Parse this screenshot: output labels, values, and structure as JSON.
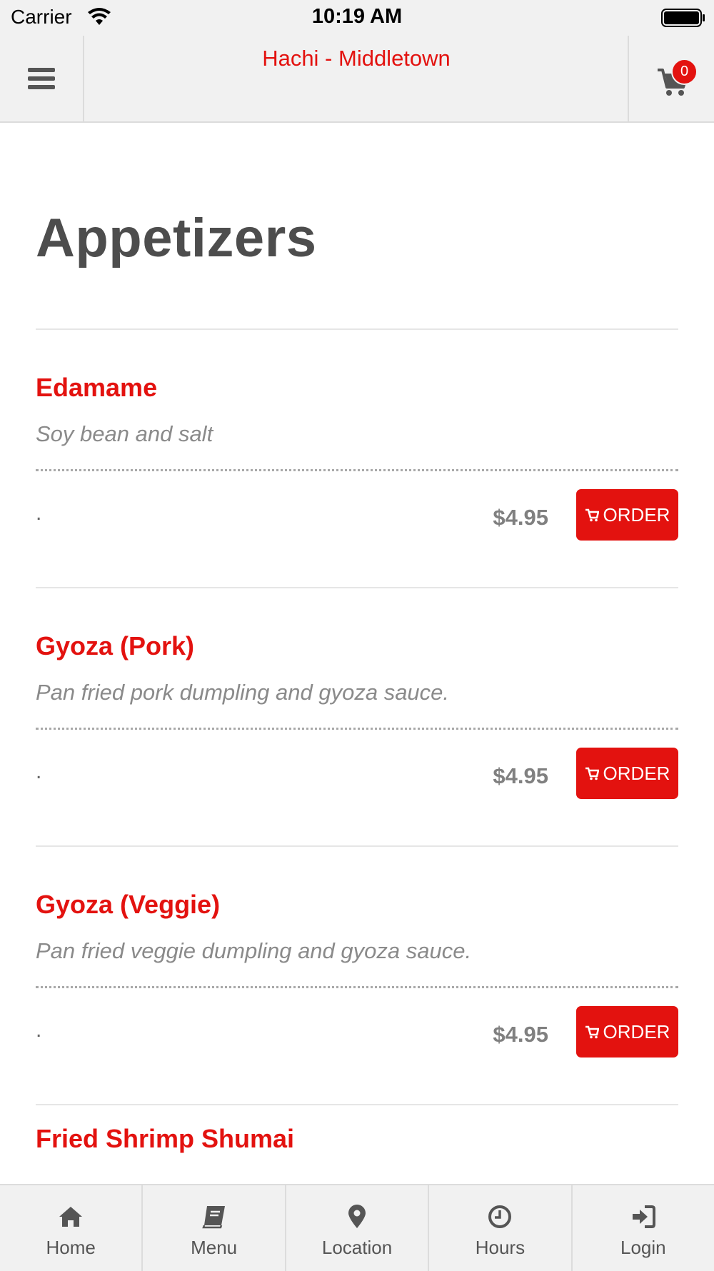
{
  "status_bar": {
    "carrier": "Carrier",
    "time": "10:19 AM"
  },
  "header": {
    "title": "Hachi - Middletown",
    "cart_count": "0"
  },
  "category": {
    "title": "Appetizers"
  },
  "items": [
    {
      "name": "Edamame",
      "description": "Soy bean and salt",
      "dot": ".",
      "price": "$4.95",
      "order_label": "ORDER"
    },
    {
      "name": "Gyoza (Pork)",
      "description": "Pan fried pork dumpling and gyoza sauce.",
      "dot": ".",
      "price": "$4.95",
      "order_label": "ORDER"
    },
    {
      "name": "Gyoza (Veggie)",
      "description": "Pan fried veggie dumpling and gyoza sauce.",
      "dot": ".",
      "price": "$4.95",
      "order_label": "ORDER"
    },
    {
      "name": "Fried Shrimp Shumai"
    }
  ],
  "tabs": [
    {
      "label": "Home",
      "icon": "home-icon"
    },
    {
      "label": "Menu",
      "icon": "book-icon"
    },
    {
      "label": "Location",
      "icon": "map-pin-icon"
    },
    {
      "label": "Hours",
      "icon": "clock-icon"
    },
    {
      "label": "Login",
      "icon": "sign-in-icon"
    }
  ],
  "colors": {
    "accent": "#e3120f",
    "heading": "#4d4d4d",
    "bar_bg": "#f1f1f1"
  }
}
